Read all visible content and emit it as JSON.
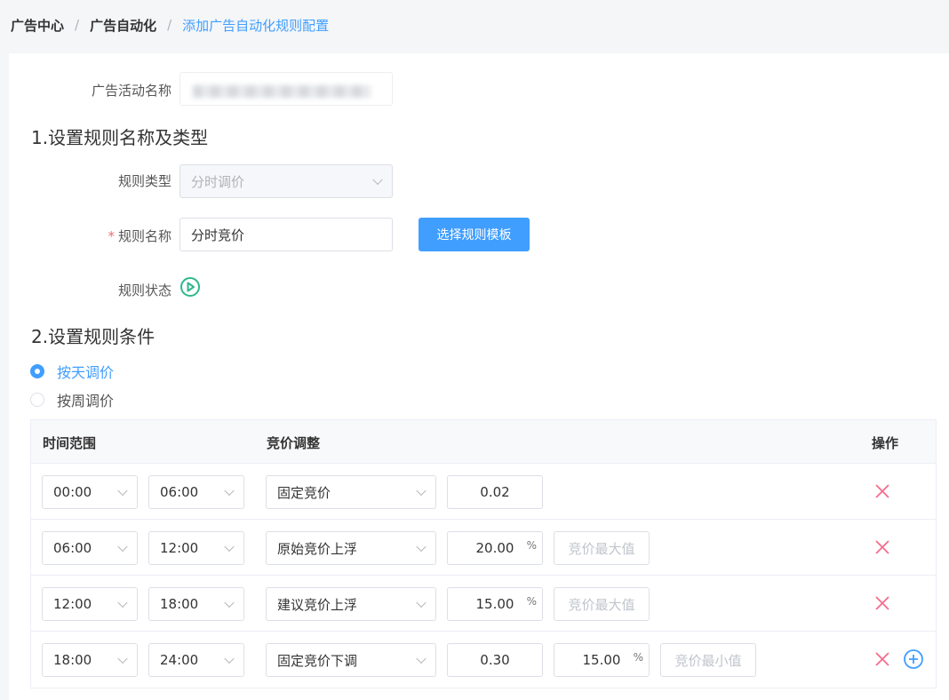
{
  "breadcrumb": {
    "items": [
      "广告中心",
      "广告自动化",
      "添加广告自动化规则配置"
    ]
  },
  "campaign": {
    "label": "广告活动名称"
  },
  "section1": {
    "title": "1.设置规则名称及类型",
    "type_label": "规则类型",
    "type_value": "分时调价",
    "name_label": "规则名称",
    "required_mark": "*",
    "name_value": "分时竞价",
    "template_button": "选择规则模板",
    "status_label": "规则状态"
  },
  "section2": {
    "title": "2.设置规则条件",
    "options": [
      "按天调价",
      "按周调价"
    ],
    "selected": "按天调价"
  },
  "table": {
    "headers": [
      "时间范围",
      "竞价调整",
      "操作"
    ],
    "rows": [
      {
        "start": "00:00",
        "end": "06:00",
        "mode": "固定竞价",
        "value": "0.02"
      },
      {
        "start": "06:00",
        "end": "12:00",
        "mode": "原始竞价上浮",
        "value": "20.00",
        "unit": "%",
        "max_placeholder": "竞价最大值"
      },
      {
        "start": "12:00",
        "end": "18:00",
        "mode": "建议竞价上浮",
        "value": "15.00",
        "unit": "%",
        "max_placeholder": "竞价最大值"
      },
      {
        "start": "18:00",
        "end": "24:00",
        "mode": "固定竞价下调",
        "value": "0.30",
        "value2": "15.00",
        "unit": "%",
        "min_placeholder": "竞价最小值"
      }
    ]
  },
  "colors": {
    "primary": "#409eff",
    "danger": "#f56c8c",
    "status_green": "#2fb78c"
  }
}
